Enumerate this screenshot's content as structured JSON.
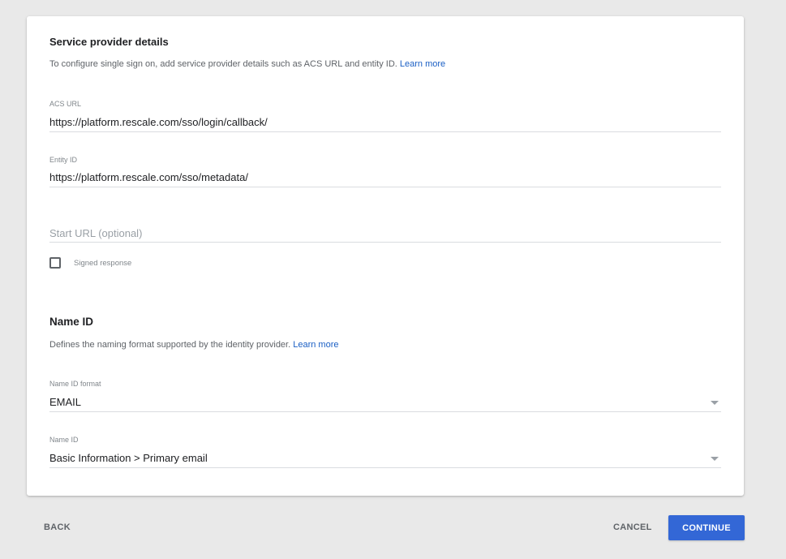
{
  "service_provider": {
    "title": "Service provider details",
    "description": "To configure single sign on, add service provider details such as ACS URL and entity ID.",
    "learn_more": "Learn more",
    "acs_url": {
      "label": "ACS URL",
      "value": "https://platform.rescale.com/sso/login/callback/"
    },
    "entity_id": {
      "label": "Entity ID",
      "value": "https://platform.rescale.com/sso/metadata/"
    },
    "start_url": {
      "placeholder": "Start URL (optional)",
      "value": ""
    },
    "signed_response": {
      "label": "Signed response",
      "checked": false
    }
  },
  "name_id": {
    "title": "Name ID",
    "description": "Defines the naming format supported by the identity provider.",
    "learn_more": "Learn more",
    "format": {
      "label": "Name ID format",
      "value": "EMAIL"
    },
    "name_id": {
      "label": "Name ID",
      "value": "Basic Information > Primary email"
    }
  },
  "footer": {
    "back_label": "BACK",
    "cancel_label": "CANCEL",
    "continue_label": "CONTINUE"
  },
  "colors": {
    "primary": "#3367d6",
    "link": "#1a5fc4",
    "background": "#e9e9e9"
  }
}
